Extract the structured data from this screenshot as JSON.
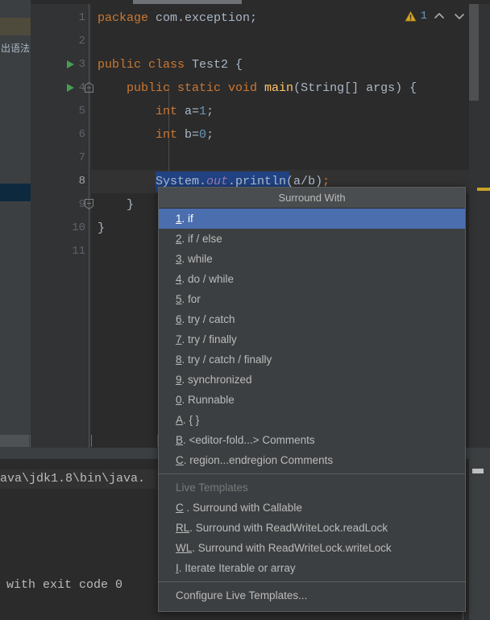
{
  "editor": {
    "code_lines": [
      {
        "n": "1",
        "segments": [
          {
            "t": "package ",
            "c": "kw"
          },
          {
            "t": "com.exception;",
            "c": "plain"
          }
        ]
      },
      {
        "n": "2",
        "segments": []
      },
      {
        "n": "3",
        "segments": [
          {
            "t": "public class ",
            "c": "kw"
          },
          {
            "t": "Test2 {",
            "c": "plain"
          }
        ],
        "run_marker": true
      },
      {
        "n": "4",
        "segments": [
          {
            "t": "    public static void ",
            "c": "kw"
          },
          {
            "t": "main",
            "c": "fn"
          },
          {
            "t": "(String[] args) {",
            "c": "plain"
          }
        ],
        "run_marker": true,
        "fold_marker": true
      },
      {
        "n": "5",
        "segments": [
          {
            "t": "        int ",
            "c": "kw"
          },
          {
            "t": "a=",
            "c": "plain"
          },
          {
            "t": "1",
            "c": "num"
          },
          {
            "t": ";",
            "c": "plain"
          }
        ]
      },
      {
        "n": "6",
        "segments": [
          {
            "t": "        int ",
            "c": "kw"
          },
          {
            "t": "b=",
            "c": "plain"
          },
          {
            "t": "0",
            "c": "num"
          },
          {
            "t": ";",
            "c": "plain"
          }
        ]
      },
      {
        "n": "7",
        "segments": []
      },
      {
        "n": "8",
        "segments": [
          {
            "t": "        System.",
            "c": "plain"
          },
          {
            "t": "out",
            "c": "stat"
          },
          {
            "t": ".println(a/b)",
            "c": "plain"
          },
          {
            "t": ";",
            "c": "kw"
          }
        ],
        "current": true,
        "selected": true
      },
      {
        "n": "9",
        "segments": [
          {
            "t": "    }",
            "c": "plain"
          }
        ],
        "fold_marker": true
      },
      {
        "n": "10",
        "segments": [
          {
            "t": "}",
            "c": "plain"
          }
        ]
      },
      {
        "n": "11",
        "segments": []
      }
    ],
    "inspection": {
      "warning_icon": "warning-triangle-icon",
      "warning_count": "1",
      "prev_icon": "chevron-up-icon",
      "next_icon": "chevron-down-icon",
      "warning_color": "#c9a227"
    }
  },
  "project_panel": {
    "clipped_label": "出语法"
  },
  "console": {
    "line1": "ava\\jdk1.8\\bin\\java.",
    "line2": "with exit code 0"
  },
  "surround_popup": {
    "title": "Surround With",
    "items": [
      {
        "mnemonic": "1",
        "sep": ".",
        "label": " if",
        "selected": true
      },
      {
        "mnemonic": "2",
        "sep": ".",
        "label": " if / else"
      },
      {
        "mnemonic": "3",
        "sep": ".",
        "label": " while"
      },
      {
        "mnemonic": "4",
        "sep": ".",
        "label": " do / while"
      },
      {
        "mnemonic": "5",
        "sep": ".",
        "label": " for"
      },
      {
        "mnemonic": "6",
        "sep": ".",
        "label": " try / catch"
      },
      {
        "mnemonic": "7",
        "sep": ".",
        "label": " try / finally"
      },
      {
        "mnemonic": "8",
        "sep": ".",
        "label": " try / catch / finally"
      },
      {
        "mnemonic": "9",
        "sep": ".",
        "label": " synchronized"
      },
      {
        "mnemonic": "0",
        "sep": ".",
        "label": " Runnable"
      },
      {
        "mnemonic": "A",
        "sep": ".",
        "label": " { }"
      },
      {
        "mnemonic": "B",
        "sep": ".",
        "label": " <editor-fold...> Comments"
      },
      {
        "mnemonic": "C",
        "sep": ".",
        "label": " region...endregion Comments"
      }
    ],
    "live_templates_header": "Live Templates",
    "live_template_items": [
      {
        "mnemonic": "C",
        "sep": " .",
        "label": " Surround with Callable"
      },
      {
        "mnemonic": "RL",
        "sep": ".",
        "label": " Surround with ReadWriteLock.readLock"
      },
      {
        "mnemonic": "WL",
        "sep": ".",
        "label": " Surround with ReadWriteLock.writeLock"
      },
      {
        "mnemonic": "I",
        "sep": ".",
        "label": " Iterate Iterable or array"
      }
    ],
    "configure_label": "Configure Live Templates...",
    "selected_bg": "#4b6eaf"
  }
}
